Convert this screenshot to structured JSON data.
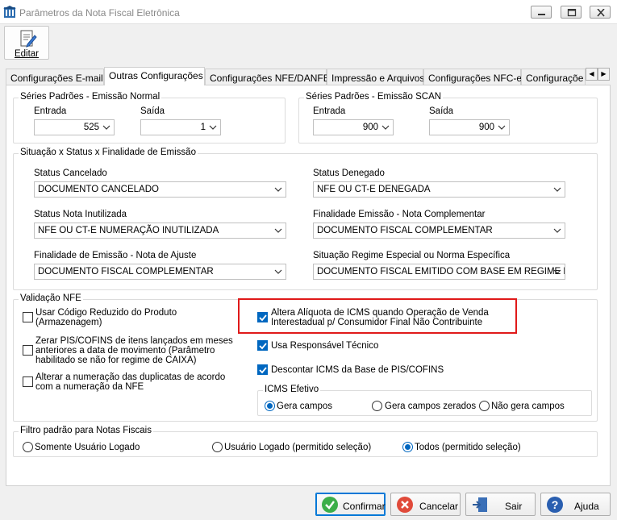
{
  "window": {
    "title": "Parâmetros da Nota Fiscal Eletrônica"
  },
  "toolbar": {
    "edit_label": "Editar"
  },
  "tabs": [
    "Configurações E-mail",
    "Outras Configurações",
    "Configurações NFE/DANFE",
    "Impressão e Arquivos",
    "Configurações NFC-e",
    "Configuraçõe"
  ],
  "series_normal": {
    "title": "Séries Padrões - Emissão Normal",
    "entrada_label": "Entrada",
    "entrada_value": "525",
    "saida_label": "Saída",
    "saida_value": "1"
  },
  "series_scan": {
    "title": "Séries Padrões - Emissão SCAN",
    "entrada_label": "Entrada",
    "entrada_value": "900",
    "saida_label": "Saída",
    "saida_value": "900"
  },
  "situacao": {
    "title": "Situação x Status x Finalidade de Emissão",
    "status_cancelado_label": "Status Cancelado",
    "status_cancelado_value": "DOCUMENTO CANCELADO",
    "status_denegado_label": "Status Denegado",
    "status_denegado_value": "NFE OU CT-E DENEGADA",
    "status_inutilizada_label": "Status Nota Inutilizada",
    "status_inutilizada_value": "NFE OU CT-E NUMERAÇÃO INUTILIZADA",
    "fin_complementar_label": "Finalidade Emissão - Nota Complementar",
    "fin_complementar_value": "DOCUMENTO FISCAL COMPLEMENTAR",
    "fin_ajuste_label": "Finalidade de Emissão - Nota de Ajuste",
    "fin_ajuste_value": "DOCUMENTO FISCAL COMPLEMENTAR",
    "regime_label": "Situação Regime Especial ou Norma Específica",
    "regime_value": "DOCUMENTO FISCAL EMITIDO COM BASE EM REGIME ESI"
  },
  "validacao": {
    "title": "Validação NFE",
    "opt1_line1": "Usar Código Reduzido do Produto",
    "opt1_line2": "(Armazenagem)",
    "opt2_line1": "Zerar PIS/COFINS de itens lançados em meses",
    "opt2_line2": "anteriores a data de movimento (Parâmetro",
    "opt2_line3": "habilitado se não for regime de CAIXA)",
    "opt3_line1": "Alterar a numeração das duplicatas de acordo",
    "opt3_line2": "com a numeração da NFE",
    "opt4_line1": "Altera Alíquota de ICMS quando Operação de Venda",
    "opt4_line2": "Interestadual p/ Consumidor Final Não Contribuinte",
    "opt5": "Usa Responsável Técnico",
    "opt6": "Descontar ICMS da Base de PIS/COFINS"
  },
  "icms_efetivo": {
    "title": "ICMS Efetivo",
    "opt1": "Gera campos",
    "opt2": "Gera campos zerados",
    "opt3": "Não gera campos"
  },
  "filtro": {
    "title": "Filtro padrão para Notas Fiscais",
    "opt1": "Somente Usuário Logado",
    "opt2": "Usuário Logado (permitido seleção)",
    "opt3": "Todos (permitido seleção)"
  },
  "buttons": {
    "confirm": "Confirmar",
    "cancel": "Cancelar",
    "exit": "Sair",
    "help": "Ajuda"
  },
  "colors": {
    "accent": "#0067c0",
    "highlight": "#e01a1a"
  }
}
